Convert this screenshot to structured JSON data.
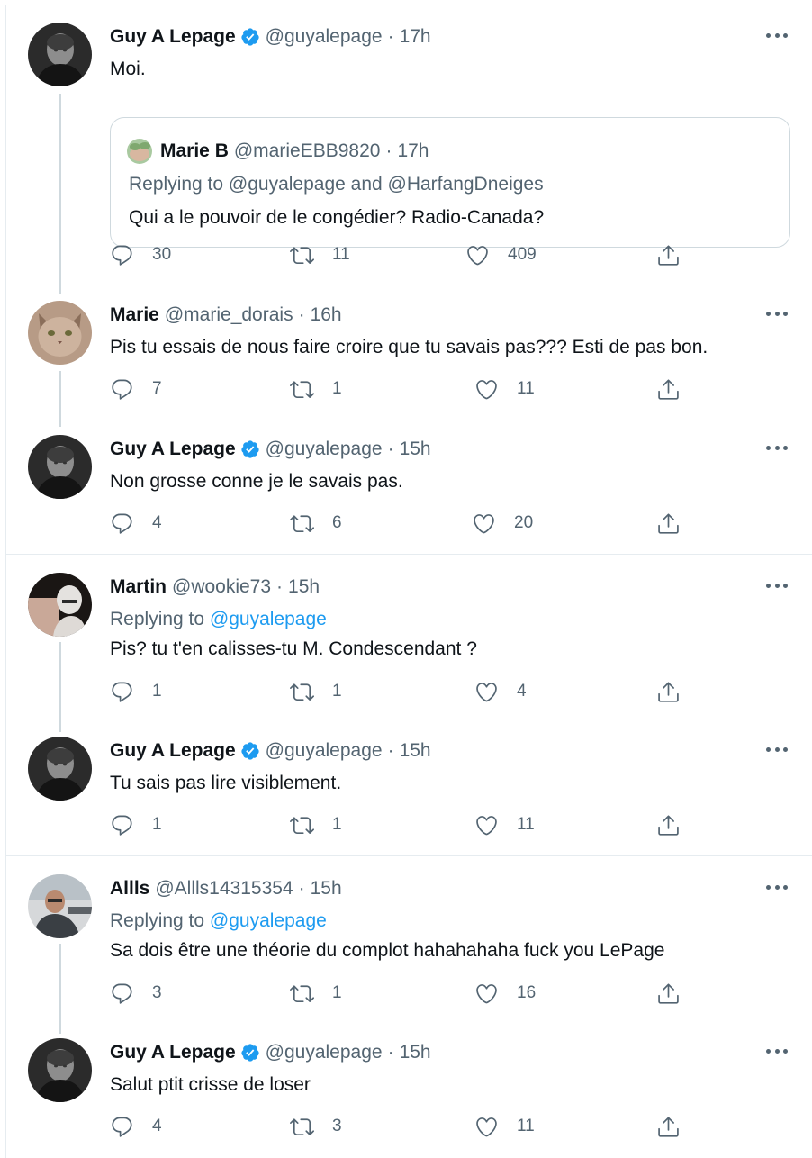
{
  "icons": {
    "reply": "speech-bubble-icon",
    "retweet": "retweet-arrows-icon",
    "like": "heart-icon",
    "share": "share-upload-icon",
    "more": "more-dots-icon",
    "verified": "verified-badge-icon"
  },
  "colors": {
    "text": "#0f1419",
    "muted": "#536471",
    "link": "#1d9bf0",
    "verified": "#1d9bf0",
    "border": "#e6ecf0"
  },
  "tweets": [
    {
      "name": "Guy A Lepage",
      "handle": "@guyalepage",
      "time": "17h",
      "text": "Moi.",
      "quote": {
        "name": "Marie B",
        "handle": "@marieEBB9820",
        "time": "17h",
        "replying": "Replying to @guyalepage and @HarfangDneiges",
        "text": "Qui a le pouvoir de le congédier? Radio-Canada?"
      },
      "replies": "30",
      "retweets": "11",
      "likes": "409"
    },
    {
      "name": "Marie",
      "handle": "@marie_dorais",
      "time": "16h",
      "text": "Pis tu essais de nous faire croire que tu savais pas??? Esti de pas bon.",
      "replies": "7",
      "retweets": "1",
      "likes": "11"
    },
    {
      "name": "Guy A Lepage",
      "handle": "@guyalepage",
      "time": "15h",
      "text": "Non grosse conne je le savais pas.",
      "replies": "4",
      "retweets": "6",
      "likes": "20"
    },
    {
      "name": "Martin",
      "handle": "@wookie73",
      "time": "15h",
      "replying_label": "Replying to",
      "replying_mention": "@guyalepage",
      "text": "Pis? tu t'en calisses-tu M. Condescendant ?",
      "replies": "1",
      "retweets": "1",
      "likes": "4"
    },
    {
      "name": "Guy A Lepage",
      "handle": "@guyalepage",
      "time": "15h",
      "text": "Tu sais pas lire visiblement.",
      "replies": "1",
      "retweets": "1",
      "likes": "11"
    },
    {
      "name": "Allls",
      "handle": "@Allls14315354",
      "time": "15h",
      "replying_label": "Replying to",
      "replying_mention": "@guyalepage",
      "text": "Sa dois être une théorie du complot hahahahaha fuck you LePage",
      "replies": "3",
      "retweets": "1",
      "likes": "16"
    },
    {
      "name": "Guy A Lepage",
      "handle": "@guyalepage",
      "time": "15h",
      "text": "Salut ptit crisse de loser",
      "replies": "4",
      "retweets": "3",
      "likes": "11"
    }
  ]
}
